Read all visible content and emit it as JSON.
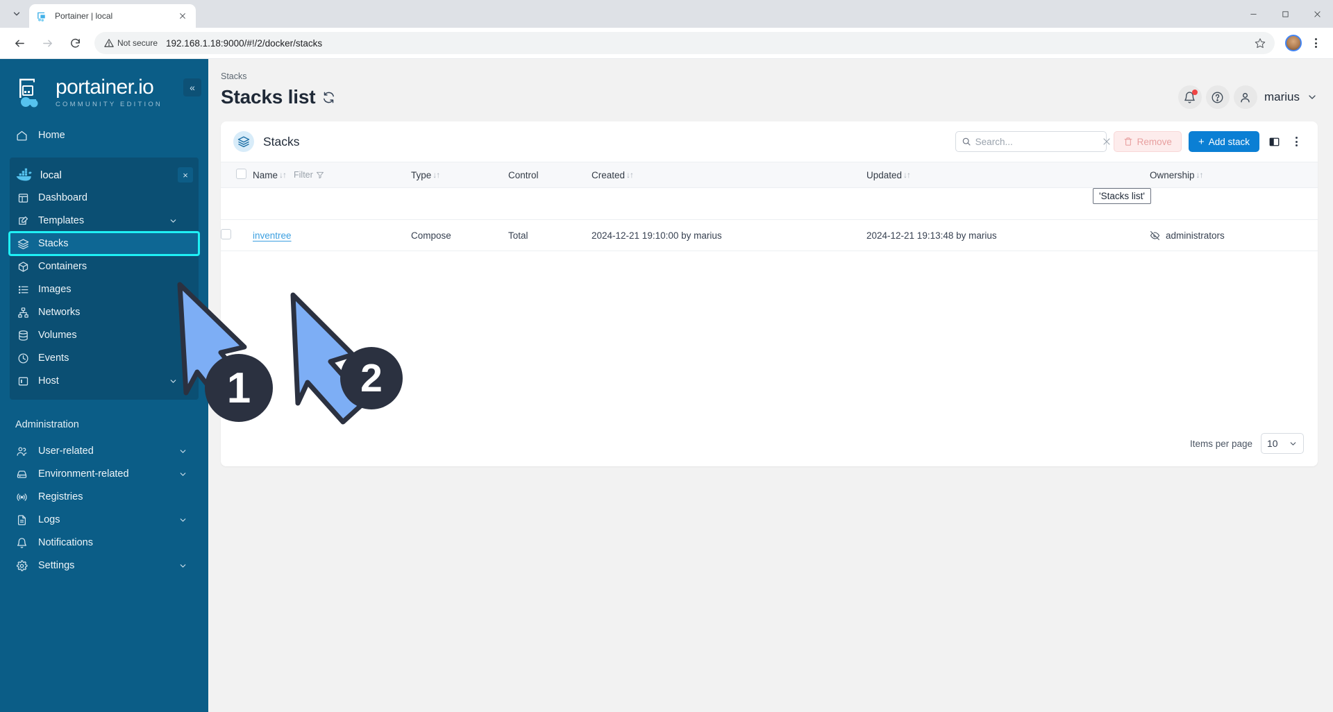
{
  "browser": {
    "tab": {
      "title": "Portainer | local",
      "favicon": "portainer-favicon"
    },
    "url": "192.168.1.18:9000/#!/2/docker/stacks",
    "security_label": "Not secure",
    "controls": {
      "back": "back-arrow",
      "forward": "forward-arrow",
      "reload": "reload-icon",
      "bookmark": "star-icon",
      "menu": "kebab-menu",
      "minimize": "minimize",
      "maximize": "maximize",
      "close": "close"
    }
  },
  "sidebar": {
    "logo": {
      "name": "portainer.io",
      "edition": "COMMUNITY EDITION"
    },
    "collapse_label": "«",
    "home": {
      "label": "Home",
      "icon": "home-icon"
    },
    "environment": {
      "name": "local",
      "icon": "docker-icon",
      "close_label": "×",
      "items": [
        {
          "label": "Dashboard",
          "icon": "dashboard-icon",
          "chevron": false,
          "active": false
        },
        {
          "label": "Templates",
          "icon": "templates-icon",
          "chevron": true,
          "active": false
        },
        {
          "label": "Stacks",
          "icon": "stacks-icon",
          "chevron": false,
          "active": true
        },
        {
          "label": "Containers",
          "icon": "containers-icon",
          "chevron": false,
          "active": false
        },
        {
          "label": "Images",
          "icon": "images-icon",
          "chevron": false,
          "active": false
        },
        {
          "label": "Networks",
          "icon": "networks-icon",
          "chevron": false,
          "active": false
        },
        {
          "label": "Volumes",
          "icon": "volumes-icon",
          "chevron": false,
          "active": false
        },
        {
          "label": "Events",
          "icon": "events-icon",
          "chevron": false,
          "active": false
        },
        {
          "label": "Host",
          "icon": "host-icon",
          "chevron": true,
          "active": false
        }
      ]
    },
    "admin_label": "Administration",
    "admin_items": [
      {
        "label": "User-related",
        "icon": "users-icon",
        "chevron": true
      },
      {
        "label": "Environment-related",
        "icon": "environment-icon",
        "chevron": true
      },
      {
        "label": "Registries",
        "icon": "registries-icon",
        "chevron": false
      },
      {
        "label": "Logs",
        "icon": "logs-icon",
        "chevron": true
      },
      {
        "label": "Notifications",
        "icon": "notifications-icon",
        "chevron": false
      },
      {
        "label": "Settings",
        "icon": "settings-icon",
        "chevron": true
      }
    ]
  },
  "header": {
    "breadcrumb": "Stacks",
    "title": "Stacks list",
    "refresh_icon": "refresh-icon",
    "tooltip": "'Stacks list'",
    "notifications_icon": "bell-icon",
    "help_icon": "help-circle-icon",
    "avatar_icon": "user-icon",
    "user": "marius",
    "chevron_icon": "chevron-down-icon"
  },
  "panel": {
    "title": "Stacks",
    "icon": "stacks-layers-icon",
    "search": {
      "placeholder": "Search...",
      "value": "",
      "icon": "search-icon",
      "clear_icon": "close-icon"
    },
    "remove_button": {
      "label": "Remove",
      "icon": "trash-icon",
      "disabled": true
    },
    "add_button": {
      "label": "Add stack",
      "plus": "+"
    },
    "columns_icon": "columns-toggle-icon",
    "menu_icon": "kebab-menu-icon"
  },
  "table": {
    "columns": [
      {
        "label": "Name",
        "sortable": true,
        "sort_glyph": "↓↑"
      },
      {
        "label": "Type",
        "sortable": true,
        "sort_glyph": "↓↑"
      },
      {
        "label": "Control",
        "sortable": false,
        "sort_glyph": ""
      },
      {
        "label": "Created",
        "sortable": true,
        "sort_glyph": "↓↑"
      },
      {
        "label": "Updated",
        "sortable": true,
        "sort_glyph": "↓↑"
      },
      {
        "label": "Ownership",
        "sortable": true,
        "sort_glyph": "↓↑"
      }
    ],
    "filter_label": "Filter",
    "filter_icon": "funnel-icon",
    "rows": [
      {
        "name": "inventree",
        "type": "Compose",
        "control": "Total",
        "created": "2024-12-21 19:10:00 by marius",
        "updated": "2024-12-21 19:13:48 by marius",
        "ownership": "administrators",
        "ownership_icon": "eye-off-icon"
      }
    ]
  },
  "footer": {
    "items_per_page_label": "Items per page",
    "items_per_page_value": "10",
    "chevron_icon": "chevron-down-icon"
  },
  "annotations": [
    {
      "number": "1",
      "target": "sidebar-item-stacks"
    },
    {
      "number": "2",
      "target": "stack-name-link-inventree"
    }
  ],
  "colors": {
    "sidebar_bg": "#0b5d87",
    "highlight": "#1ff0f5",
    "primary_button": "#0b7fd4",
    "link": "#3b9fe0",
    "annotation_fill": "#7daef5",
    "annotation_stroke": "#2b3140"
  }
}
